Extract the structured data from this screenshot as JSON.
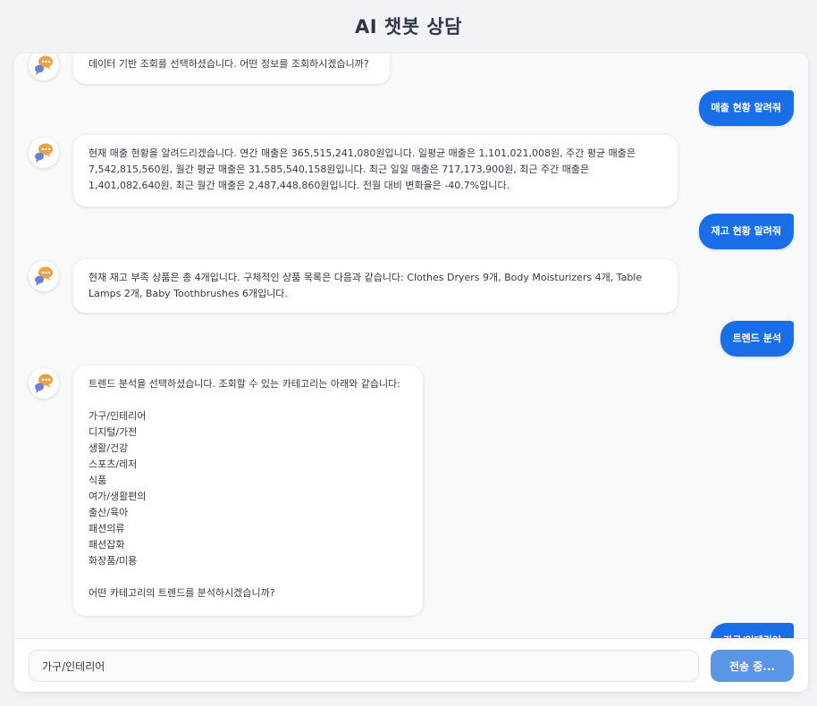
{
  "header": {
    "title": "AI 챗봇 상담"
  },
  "messages": [
    {
      "role": "bot",
      "text": "데이터 기반 조회를 선택하셨습니다. 어떤 정보를 조회하시겠습니까?"
    },
    {
      "role": "user",
      "text": "매출 현황 알려줘"
    },
    {
      "role": "bot",
      "text": "현재 매출 현황을 알려드리겠습니다. 연간 매출은 365,515,241,080원입니다. 일평균 매출은 1,101,021,008원, 주간 평균 매출은 7,542,815,560원, 월간 평균 매출은 31,585,540,158원입니다. 최근 일일 매출은 717,173,900원, 최근 주간 매출은 1,401,082,640원, 최근 월간 매출은 2,487,448,860원입니다. 전월 대비 변화율은 -40.7%입니다."
    },
    {
      "role": "user",
      "text": "재고 현황 알려줘"
    },
    {
      "role": "bot",
      "text": "현재 재고 부족 상품은 총 4개입니다. 구체적인 상품 목록은 다음과 같습니다: Clothes Dryers 9개, Body Moisturizers 4개, Table Lamps 2개, Baby Toothbrushes 6개입니다."
    },
    {
      "role": "user",
      "text": "트렌드 분석"
    },
    {
      "role": "bot",
      "text": "트렌드 분석을 선택하셨습니다. 조회할 수 있는 카테고리는 아래와 같습니다:\n\n가구/인테리어\n디지털/가전\n생활/건강\n스포츠/레저\n식품\n여가/생활편의\n출산/육아\n패션의류\n패션잡화\n화장품/미용\n\n어떤 카테고리의 트렌드를 분석하시겠습니까?"
    },
    {
      "role": "user",
      "text": "가구/인테리어"
    }
  ],
  "input": {
    "value": "가구/인테리어",
    "placeholder": ""
  },
  "send_button": {
    "label": "전송 중..."
  },
  "colors": {
    "user_bubble": "#1a6fe8",
    "send_button": "#5b95e8",
    "background": "#f1f3f6"
  },
  "icons": {
    "bot_avatar": "chat-bubbles-icon"
  }
}
